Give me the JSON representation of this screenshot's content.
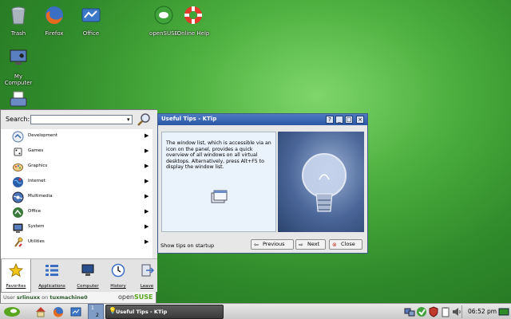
{
  "desktop": {
    "icons": [
      {
        "label": "Trash",
        "icon": "trash-icon"
      },
      {
        "label": "Firefox",
        "icon": "firefox-icon"
      },
      {
        "label": "Office",
        "icon": "office-icon"
      },
      {
        "label": "openSUSE",
        "icon": "opensuse-icon"
      },
      {
        "label": "Online Help",
        "icon": "help-lifebuoy-icon"
      },
      {
        "label": "My Computer",
        "icon": "computer-icon"
      },
      {
        "label": "",
        "icon": "printer-icon"
      }
    ]
  },
  "kickoff": {
    "search_label": "Search:",
    "search_value": "",
    "applications": [
      {
        "label": "Development",
        "icon": "development-icon"
      },
      {
        "label": "Games",
        "icon": "games-icon"
      },
      {
        "label": "Graphics",
        "icon": "graphics-icon"
      },
      {
        "label": "Internet",
        "icon": "internet-icon"
      },
      {
        "label": "Multimedia",
        "icon": "multimedia-icon"
      },
      {
        "label": "Office",
        "icon": "office-icon"
      },
      {
        "label": "System",
        "icon": "system-icon"
      },
      {
        "label": "Utilities",
        "icon": "utilities-icon"
      }
    ],
    "tabs": [
      {
        "label": "Favorites",
        "icon": "star-icon"
      },
      {
        "label": "Applications",
        "icon": "applications-list-icon"
      },
      {
        "label": "Computer",
        "icon": "computer-icon"
      },
      {
        "label": "History",
        "icon": "clock-icon"
      },
      {
        "label": "Leave",
        "icon": "leave-icon"
      }
    ],
    "user_prefix": "User",
    "user_name": "srlinuxx",
    "user_on": "on",
    "host": "tuxmachine0",
    "brand_open": "open",
    "brand_suse": "SUSE"
  },
  "ktip": {
    "title": "Useful Tips - KTip",
    "tip_text": "The window list, which is accessible via an icon on the panel, provides a quick overview of all windows on all virtual desktops. Alternatively, press Alt+F5 to display the window list.",
    "show_tips_label": "Show tips on startup",
    "previous_label": "Previous",
    "next_label": "Next",
    "close_label": "Close",
    "title_buttons": [
      "?",
      "_",
      "□",
      "×"
    ]
  },
  "taskbar": {
    "pager_1": "1",
    "pager_2": "2",
    "task_label": "Useful Tips - KTip",
    "clock": "06:52 pm"
  },
  "colors": {
    "desktop_green": "#3f9a34",
    "title_blue": "#2b56a5",
    "brand_green": "#5aa51e"
  }
}
